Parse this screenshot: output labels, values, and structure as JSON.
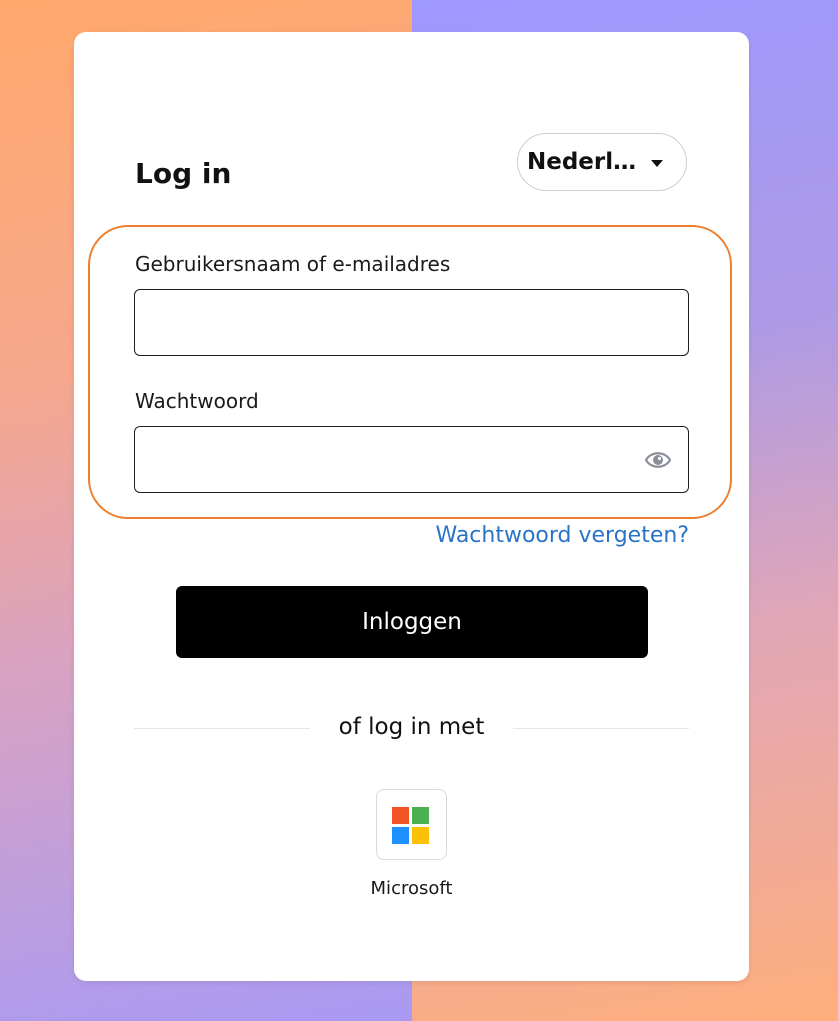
{
  "login": {
    "title": "Log in",
    "language": {
      "selected": "Nederla..."
    },
    "username": {
      "label": "Gebruikersnaam of e-mailadres",
      "value": "",
      "placeholder": ""
    },
    "password": {
      "label": "Wachtwoord",
      "value": "",
      "placeholder": ""
    },
    "forgot_label": "Wachtwoord vergeten?",
    "submit_label": "Inloggen",
    "divider_label": "of log in met",
    "providers": [
      {
        "name": "Microsoft",
        "icon": "microsoft-logo-icon"
      }
    ]
  },
  "colors": {
    "highlight": "#ed7f2f",
    "link": "#2b73c9",
    "button": "#000000",
    "bg_orange": "#ffa86c",
    "bg_purple": "#9f98ff",
    "ms_red": "#f35325",
    "ms_green": "#4caf50",
    "ms_blue": "#1e90ff",
    "ms_yellow": "#ffc107"
  }
}
